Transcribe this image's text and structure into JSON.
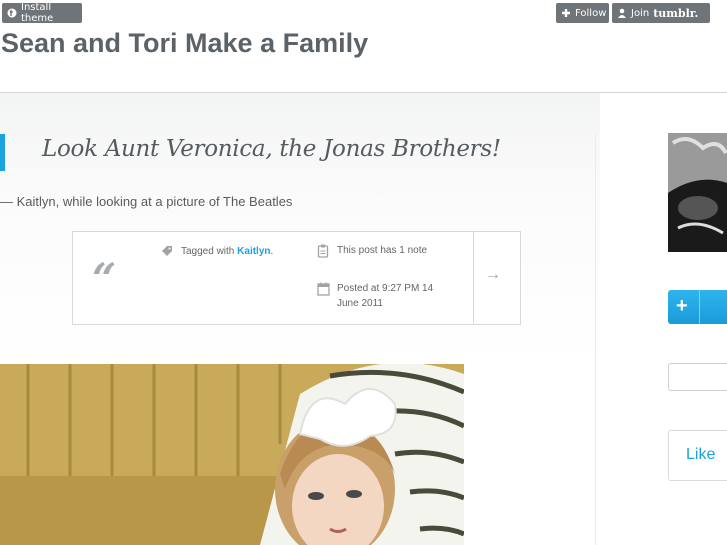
{
  "tumblr_controls": {
    "install_label": "Install theme",
    "follow_label": "Follow",
    "join_label": "Join",
    "join_brand": "tumblr."
  },
  "blog": {
    "title": "Sean and Tori Make a Family"
  },
  "post": {
    "quote": "Look Aunt Veronica, the Jonas Brothers!",
    "source": "— Kaitlyn, while looking at a picture of The Beatles",
    "quote_mark": "“",
    "tagged_prefix": "Tagged with",
    "tag": "Kaitlyn",
    "tag_suffix": ".",
    "notes": "This post has 1 note",
    "posted": "Posted at 9:27 PM 14 June 2011",
    "arrow": "→"
  },
  "sidebar": {
    "follow_plus": "+",
    "like_label": "Like"
  },
  "colors": {
    "accent": "#1aa3dc",
    "title": "#5c6368",
    "tumblr_button": "#6f7478"
  }
}
